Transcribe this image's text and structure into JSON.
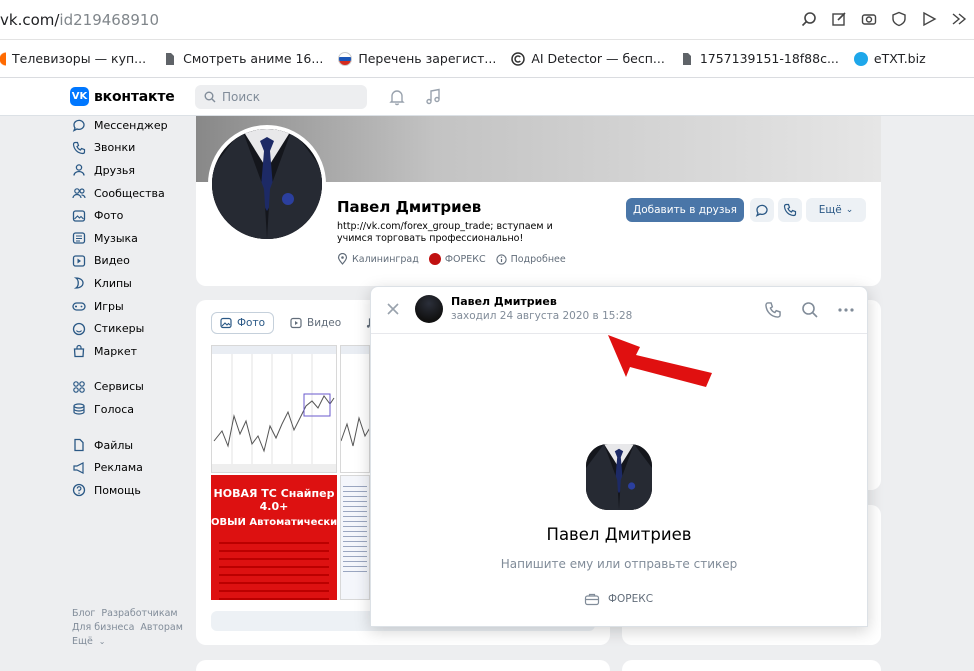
{
  "browser": {
    "url_host": "vk.com/",
    "url_path": "id219468910",
    "bookmarks": [
      {
        "label": "Телевизоры — куп...",
        "icon": "orange-circle-icon"
      },
      {
        "label": "Смотреть аниме 16...",
        "icon": "file-icon"
      },
      {
        "label": "Перечень зарегист...",
        "icon": "flag-icon"
      },
      {
        "label": "AI Detector — бесп...",
        "icon": "copyright-icon"
      },
      {
        "label": "1757139151-18f88c...",
        "icon": "file-icon"
      },
      {
        "label": "eTXT.biz",
        "icon": "etxt-icon"
      }
    ]
  },
  "header": {
    "logo_text": "вконтакте",
    "search_placeholder": "Поиск"
  },
  "sidebar": {
    "items": [
      {
        "label": "Мессенджер",
        "icon": "chat-icon"
      },
      {
        "label": "Звонки",
        "icon": "phone-icon"
      },
      {
        "label": "Друзья",
        "icon": "user-icon"
      },
      {
        "label": "Сообщества",
        "icon": "users-icon"
      },
      {
        "label": "Фото",
        "icon": "photo-icon"
      },
      {
        "label": "Музыка",
        "icon": "music-icon"
      },
      {
        "label": "Видео",
        "icon": "video-icon"
      },
      {
        "label": "Клипы",
        "icon": "clips-icon"
      },
      {
        "label": "Игры",
        "icon": "gamepad-icon"
      },
      {
        "label": "Стикеры",
        "icon": "smile-icon"
      },
      {
        "label": "Маркет",
        "icon": "bag-icon"
      }
    ],
    "items2": [
      {
        "label": "Сервисы",
        "icon": "grid-icon"
      },
      {
        "label": "Голоса",
        "icon": "coins-icon"
      }
    ],
    "items3": [
      {
        "label": "Файлы",
        "icon": "file-icon"
      },
      {
        "label": "Реклама",
        "icon": "megaphone-icon"
      },
      {
        "label": "Помощь",
        "icon": "help-icon"
      }
    ],
    "footer": {
      "blog": "Блог",
      "dev": "Разработчикам",
      "biz": "Для бизнеса",
      "authors": "Авторам",
      "more": "Ещё"
    }
  },
  "profile": {
    "name": "Павел Дмитриев",
    "status": "http://vk.com/forex_group_trade; вступаем и учимся торговать профессионально!",
    "city": "Калининград",
    "group": "ФОРЕКС",
    "details": "Подробнее",
    "add_friend": "Добавить в друзья",
    "more": "Ещё"
  },
  "photos": {
    "tabs": [
      "Фото",
      "Видео",
      "М"
    ],
    "promo_title": "НОВАЯ ТС Снайпер 4.0+",
    "promo_sub": "ОВЫЙ Автоматический робо"
  },
  "popup": {
    "name": "Павел Дмитриев",
    "last_seen": "заходил 24 августа 2020 в 15:28",
    "big_name": "Павел Дмитриев",
    "hint": "Напишите ему или отправьте стикер",
    "group": "ФОРЕКС"
  },
  "colors": {
    "vk_blue": "#0077ff",
    "button_blue": "#4a76a8",
    "arrow_red": "#e01010"
  }
}
